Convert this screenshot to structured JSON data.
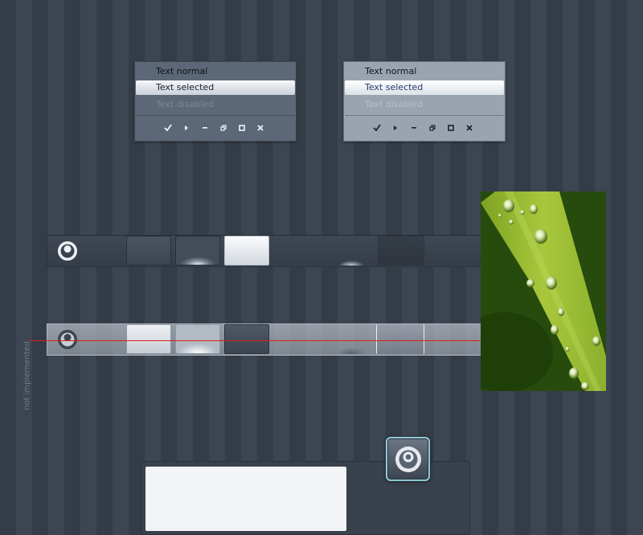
{
  "menus": [
    {
      "theme": "dark",
      "items": [
        {
          "label": "Text normal",
          "state": "normal"
        },
        {
          "label": "Text selected",
          "state": "selected"
        },
        {
          "label": "Text disabled",
          "state": "disabled"
        }
      ],
      "icons": [
        "check-icon",
        "play-icon",
        "minimize-icon",
        "restore-icon",
        "maximize-icon",
        "close-icon"
      ]
    },
    {
      "theme": "light",
      "items": [
        {
          "label": "Text normal",
          "state": "normal"
        },
        {
          "label": "Text selected",
          "state": "selected"
        },
        {
          "label": "Text disabled",
          "state": "disabled"
        }
      ],
      "icons": [
        "check-icon",
        "play-icon",
        "minimize-icon",
        "restore-icon",
        "maximize-icon",
        "close-icon"
      ]
    }
  ],
  "toolbars": [
    {
      "theme": "dark",
      "logo": "app-logo-icon",
      "buttons": [
        "normal",
        "hover",
        "pressed",
        "glow",
        "sunken"
      ]
    },
    {
      "theme": "light",
      "logo": "app-logo-icon",
      "buttons": [
        "normal",
        "hover",
        "pressed",
        "glow",
        "sunken"
      ]
    }
  ],
  "annotation": {
    "label": "not implemented",
    "line_color": "#d62020"
  },
  "photo": {
    "subject": "green leaf with water droplets"
  },
  "app_icon": {
    "name": "app-logo-icon",
    "border_color": "#8ec8d4"
  },
  "colors": {
    "background": "#38414c",
    "accent": "#8ec8d4"
  }
}
